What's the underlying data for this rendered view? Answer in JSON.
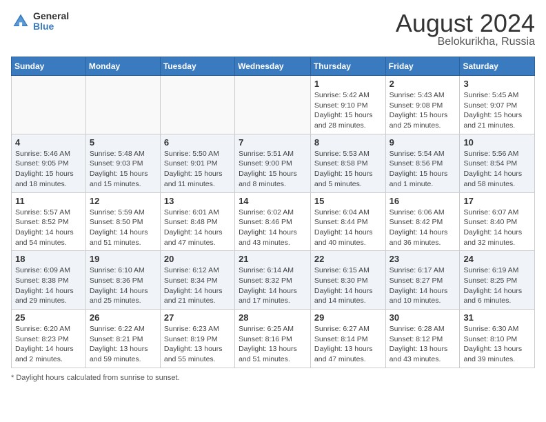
{
  "header": {
    "logo_line1": "General",
    "logo_line2": "Blue",
    "title": "August 2024",
    "subtitle": "Belokurikha, Russia"
  },
  "weekdays": [
    "Sunday",
    "Monday",
    "Tuesday",
    "Wednesday",
    "Thursday",
    "Friday",
    "Saturday"
  ],
  "weeks": [
    [
      {
        "day": "",
        "info": ""
      },
      {
        "day": "",
        "info": ""
      },
      {
        "day": "",
        "info": ""
      },
      {
        "day": "",
        "info": ""
      },
      {
        "day": "1",
        "info": "Sunrise: 5:42 AM\nSunset: 9:10 PM\nDaylight: 15 hours\nand 28 minutes."
      },
      {
        "day": "2",
        "info": "Sunrise: 5:43 AM\nSunset: 9:08 PM\nDaylight: 15 hours\nand 25 minutes."
      },
      {
        "day": "3",
        "info": "Sunrise: 5:45 AM\nSunset: 9:07 PM\nDaylight: 15 hours\nand 21 minutes."
      }
    ],
    [
      {
        "day": "4",
        "info": "Sunrise: 5:46 AM\nSunset: 9:05 PM\nDaylight: 15 hours\nand 18 minutes."
      },
      {
        "day": "5",
        "info": "Sunrise: 5:48 AM\nSunset: 9:03 PM\nDaylight: 15 hours\nand 15 minutes."
      },
      {
        "day": "6",
        "info": "Sunrise: 5:50 AM\nSunset: 9:01 PM\nDaylight: 15 hours\nand 11 minutes."
      },
      {
        "day": "7",
        "info": "Sunrise: 5:51 AM\nSunset: 9:00 PM\nDaylight: 15 hours\nand 8 minutes."
      },
      {
        "day": "8",
        "info": "Sunrise: 5:53 AM\nSunset: 8:58 PM\nDaylight: 15 hours\nand 5 minutes."
      },
      {
        "day": "9",
        "info": "Sunrise: 5:54 AM\nSunset: 8:56 PM\nDaylight: 15 hours\nand 1 minute."
      },
      {
        "day": "10",
        "info": "Sunrise: 5:56 AM\nSunset: 8:54 PM\nDaylight: 14 hours\nand 58 minutes."
      }
    ],
    [
      {
        "day": "11",
        "info": "Sunrise: 5:57 AM\nSunset: 8:52 PM\nDaylight: 14 hours\nand 54 minutes."
      },
      {
        "day": "12",
        "info": "Sunrise: 5:59 AM\nSunset: 8:50 PM\nDaylight: 14 hours\nand 51 minutes."
      },
      {
        "day": "13",
        "info": "Sunrise: 6:01 AM\nSunset: 8:48 PM\nDaylight: 14 hours\nand 47 minutes."
      },
      {
        "day": "14",
        "info": "Sunrise: 6:02 AM\nSunset: 8:46 PM\nDaylight: 14 hours\nand 43 minutes."
      },
      {
        "day": "15",
        "info": "Sunrise: 6:04 AM\nSunset: 8:44 PM\nDaylight: 14 hours\nand 40 minutes."
      },
      {
        "day": "16",
        "info": "Sunrise: 6:06 AM\nSunset: 8:42 PM\nDaylight: 14 hours\nand 36 minutes."
      },
      {
        "day": "17",
        "info": "Sunrise: 6:07 AM\nSunset: 8:40 PM\nDaylight: 14 hours\nand 32 minutes."
      }
    ],
    [
      {
        "day": "18",
        "info": "Sunrise: 6:09 AM\nSunset: 8:38 PM\nDaylight: 14 hours\nand 29 minutes."
      },
      {
        "day": "19",
        "info": "Sunrise: 6:10 AM\nSunset: 8:36 PM\nDaylight: 14 hours\nand 25 minutes."
      },
      {
        "day": "20",
        "info": "Sunrise: 6:12 AM\nSunset: 8:34 PM\nDaylight: 14 hours\nand 21 minutes."
      },
      {
        "day": "21",
        "info": "Sunrise: 6:14 AM\nSunset: 8:32 PM\nDaylight: 14 hours\nand 17 minutes."
      },
      {
        "day": "22",
        "info": "Sunrise: 6:15 AM\nSunset: 8:30 PM\nDaylight: 14 hours\nand 14 minutes."
      },
      {
        "day": "23",
        "info": "Sunrise: 6:17 AM\nSunset: 8:27 PM\nDaylight: 14 hours\nand 10 minutes."
      },
      {
        "day": "24",
        "info": "Sunrise: 6:19 AM\nSunset: 8:25 PM\nDaylight: 14 hours\nand 6 minutes."
      }
    ],
    [
      {
        "day": "25",
        "info": "Sunrise: 6:20 AM\nSunset: 8:23 PM\nDaylight: 14 hours\nand 2 minutes."
      },
      {
        "day": "26",
        "info": "Sunrise: 6:22 AM\nSunset: 8:21 PM\nDaylight: 13 hours\nand 59 minutes."
      },
      {
        "day": "27",
        "info": "Sunrise: 6:23 AM\nSunset: 8:19 PM\nDaylight: 13 hours\nand 55 minutes."
      },
      {
        "day": "28",
        "info": "Sunrise: 6:25 AM\nSunset: 8:16 PM\nDaylight: 13 hours\nand 51 minutes."
      },
      {
        "day": "29",
        "info": "Sunrise: 6:27 AM\nSunset: 8:14 PM\nDaylight: 13 hours\nand 47 minutes."
      },
      {
        "day": "30",
        "info": "Sunrise: 6:28 AM\nSunset: 8:12 PM\nDaylight: 13 hours\nand 43 minutes."
      },
      {
        "day": "31",
        "info": "Sunrise: 6:30 AM\nSunset: 8:10 PM\nDaylight: 13 hours\nand 39 minutes."
      }
    ]
  ],
  "footer": "Daylight hours"
}
